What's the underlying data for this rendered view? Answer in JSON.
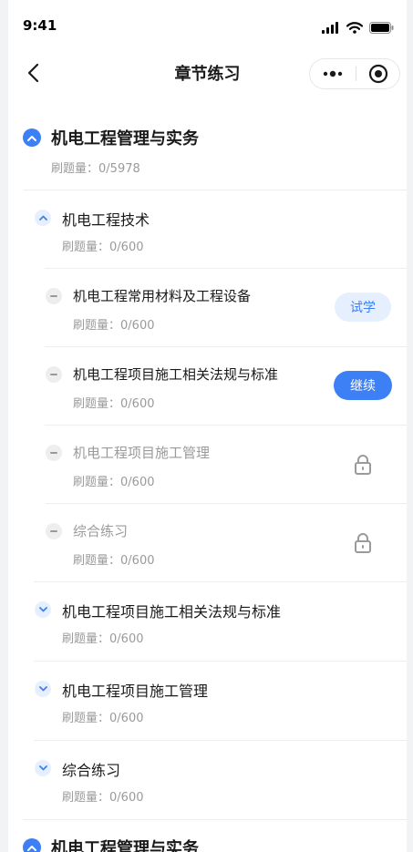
{
  "status_bar": {
    "time": "9:41",
    "icons": [
      "signal-icon",
      "wifi-icon",
      "battery-icon"
    ]
  },
  "nav": {
    "title": "章节练习",
    "back_icon": "chevron-left-icon",
    "more_icon": "more-dots-icon",
    "close_icon": "target-close-icon"
  },
  "count_prefix": "刷题量：",
  "colors": {
    "accent": "#3d7ff5",
    "accent_soft": "#e6effe",
    "muted_text": "#9a9a9a"
  },
  "chapters": [
    {
      "title": "机电工程管理与实务",
      "count": "0/5978",
      "expanded": true,
      "sections": [
        {
          "title": "机电工程技术",
          "count": "0/600",
          "expanded": true,
          "items": [
            {
              "title": "机电工程常用材料及工程设备",
              "count": "0/600",
              "action": "试学",
              "locked": false
            },
            {
              "title": "机电工程项目施工相关法规与标准",
              "count": "0/600",
              "action": "继续",
              "locked": false
            },
            {
              "title": "机电工程项目施工管理",
              "count": "0/600",
              "locked": true
            },
            {
              "title": "综合练习",
              "count": "0/600",
              "locked": true
            }
          ]
        },
        {
          "title": "机电工程项目施工相关法规与标准",
          "count": "0/600",
          "expanded": false
        },
        {
          "title": "机电工程项目施工管理",
          "count": "0/600",
          "expanded": false
        },
        {
          "title": "综合练习",
          "count": "0/600",
          "expanded": false
        }
      ]
    },
    {
      "title": "机电工程管理与实务",
      "expanded": true
    }
  ]
}
